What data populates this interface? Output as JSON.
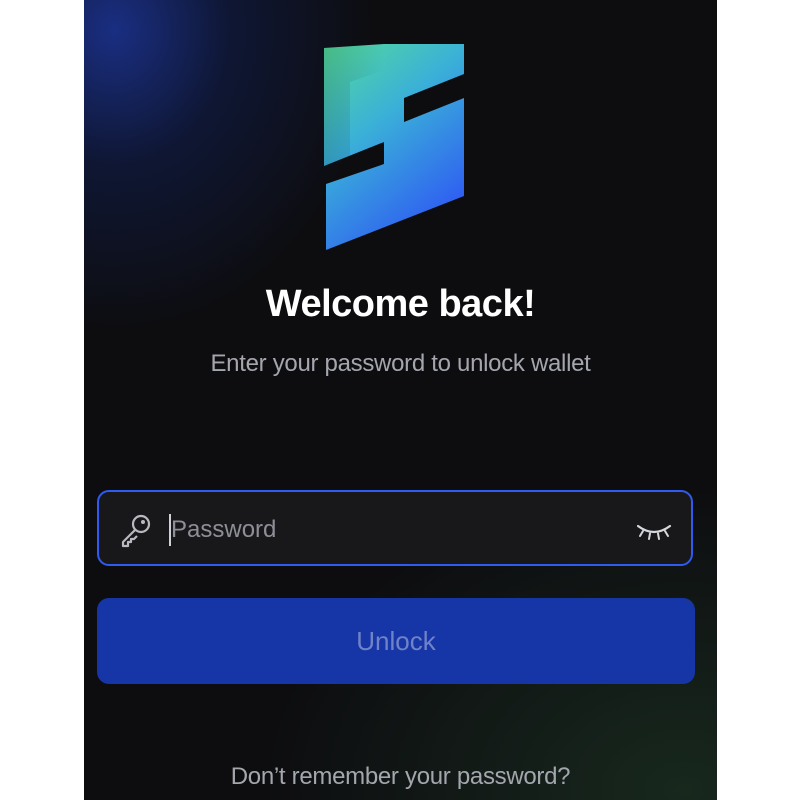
{
  "welcome": {
    "title": "Welcome back!",
    "subtitle": "Enter your password to unlock wallet"
  },
  "password_field": {
    "placeholder": "Password",
    "value": "",
    "left_icon": "key-icon",
    "right_icon": "eye-closed-icon"
  },
  "unlock_button": {
    "label": "Unlock"
  },
  "forgot_link": {
    "label": "Don’t remember your password?"
  },
  "colors": {
    "accent": "#2f5bf0",
    "button": "#1636a8",
    "background": "#0d0d10",
    "logo_gradient_top": "#55dc9a",
    "logo_gradient_bottom": "#2f5ef2"
  },
  "logo": {
    "icon": "logo-s-icon"
  }
}
